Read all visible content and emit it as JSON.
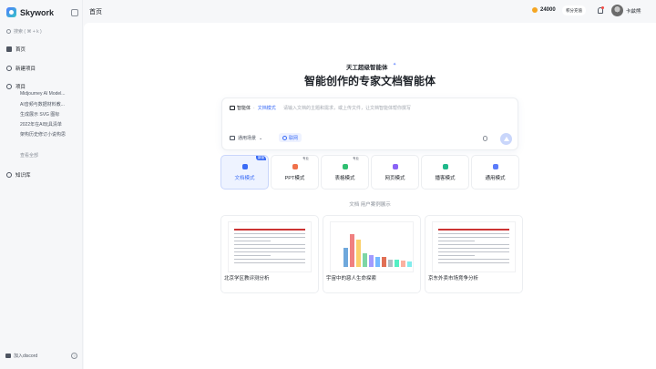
{
  "sidebar": {
    "brand": "Skywork",
    "search_placeholder": "搜索 ( ⌘ + k )",
    "nav": {
      "home": "首页",
      "new_project": "新建项目",
      "projects": "项目",
      "knowledge": "知识库"
    },
    "projects": [
      "Midjourney AI Model...",
      "AI音频与数据材料教...",
      "生成展示 SVG 图标",
      "2022年在AI玩具清单",
      "架构历史修订小说构思"
    ],
    "view_all": "查看全部",
    "footer": "加入discord"
  },
  "header": {
    "title": "首页",
    "credits": "24000",
    "recharge": "积分充值",
    "username": "卡兹熊"
  },
  "main": {
    "badge": "天工超级智能体",
    "badge_spark": "✦",
    "hero": "智能创作的专家文档智能体",
    "composer": {
      "agent": "智能体",
      "mode": "文档模式",
      "placeholder": "请输入文档的主题和需求，或上传文件，让文档智能体帮你撰写",
      "scene": "通用场景",
      "net": "联网"
    },
    "modes": [
      {
        "label": "文档模式",
        "tag": "新版",
        "color": "#3b6cf6",
        "active": true
      },
      {
        "label": "PPT模式",
        "tag": "专业",
        "color": "#f0714b",
        "active": false
      },
      {
        "label": "表格模式",
        "tag": "专业",
        "color": "#2fbf71",
        "active": false
      },
      {
        "label": "网页模式",
        "tag": "",
        "color": "#8a63f6",
        "active": false
      },
      {
        "label": "播客模式",
        "tag": "",
        "color": "#1fb88a",
        "active": false
      },
      {
        "label": "通用模式",
        "tag": "",
        "color": "#5b7cfa",
        "active": false
      }
    ],
    "cases_title": "文档 用户案例展示",
    "cases": [
      {
        "caption": "北京学区教评测分析"
      },
      {
        "caption": "宇宙中的惡人生命探索"
      },
      {
        "caption": "京东外卖市场竞争分析"
      }
    ],
    "case_bar_colors": [
      "#6fa8dc",
      "#f08080",
      "#fbd06b",
      "#7ed6a5",
      "#a29bfe",
      "#74b9ff",
      "#e17055",
      "#b2bec3",
      "#55efc4",
      "#fab1a0",
      "#81ecec"
    ],
    "case_bar_values": [
      0.55,
      0.95,
      0.8,
      0.4,
      0.35,
      0.3,
      0.28,
      0.22,
      0.2,
      0.18,
      0.15
    ]
  }
}
